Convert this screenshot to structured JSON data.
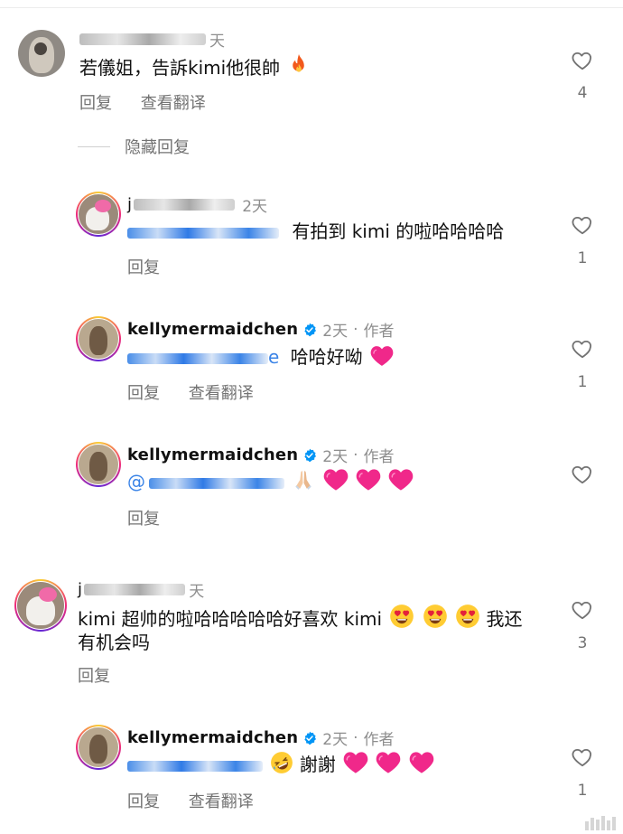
{
  "comments": [
    {
      "time": "天",
      "text": "若儀姐，告訴kimi他很帥",
      "actions": [
        "回复",
        "查看翻译"
      ],
      "likes": "4",
      "hide_replies": "隐藏回复"
    },
    {
      "username_initial": "j",
      "time": "2天",
      "text": "有拍到 kimi 的啦哈哈哈哈",
      "actions": [
        "回复"
      ],
      "likes": "1"
    },
    {
      "username": "kellymermaidchen",
      "time": "2天",
      "author_label": "作者",
      "text": "哈哈好呦",
      "mention_end": "e",
      "actions": [
        "回复",
        "查看翻译"
      ],
      "likes": "1"
    },
    {
      "username": "kellymermaidchen",
      "time": "2天",
      "author_label": "作者",
      "mention_start": "@",
      "actions": [
        "回复"
      ],
      "likes": ""
    },
    {
      "username_initial": "j",
      "time": "天",
      "text_line1": "kimi 超帅的啦哈哈哈哈哈好喜欢 kimi",
      "text_line1_end": "我还",
      "text_line2": "有机会吗",
      "actions": [
        "回复"
      ],
      "likes": "3"
    },
    {
      "username": "kellymermaidchen",
      "time": "2天",
      "author_label": "作者",
      "text": "謝謝",
      "actions": [
        "回复",
        "查看翻译"
      ],
      "likes": "1"
    }
  ],
  "colors": {
    "heart_pink": "#f0288a",
    "verified_blue": "#0095f6",
    "secondary_text": "#737373"
  },
  "icons": [
    "heart-outline-icon",
    "verified-badge-icon",
    "fire-emoji",
    "pink-heart-emoji",
    "pray-emoji",
    "heart-eyes-emoji",
    "rofl-emoji"
  ]
}
